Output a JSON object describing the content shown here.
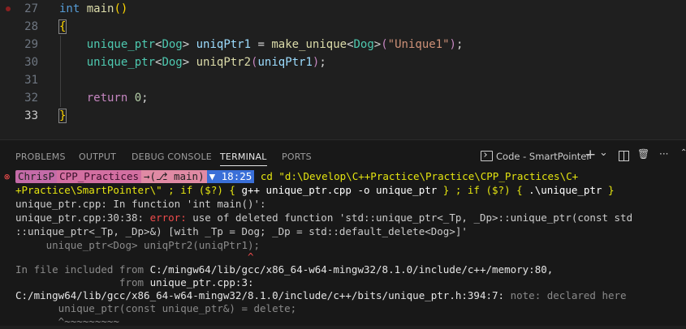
{
  "editor": {
    "lines": [
      {
        "num": "27",
        "tokens": [
          {
            "t": "int",
            "c": "kw"
          },
          {
            "t": " ",
            "c": "pl"
          },
          {
            "t": "main",
            "c": "fn"
          },
          {
            "t": "()",
            "c": "br"
          }
        ]
      },
      {
        "num": "28",
        "tokens": [
          {
            "t": "{",
            "c": "br"
          }
        ]
      },
      {
        "num": "29",
        "tokens": [
          {
            "t": "    ",
            "c": "pl"
          },
          {
            "t": "unique_ptr",
            "c": "ty"
          },
          {
            "t": "<",
            "c": "pl"
          },
          {
            "t": "Dog",
            "c": "ty"
          },
          {
            "t": "> ",
            "c": "pl"
          },
          {
            "t": "uniqPtr1",
            "c": "var"
          },
          {
            "t": " = ",
            "c": "pl"
          },
          {
            "t": "make_unique",
            "c": "fn"
          },
          {
            "t": "<",
            "c": "pl"
          },
          {
            "t": "Dog",
            "c": "ty"
          },
          {
            "t": ">",
            "c": "pl"
          },
          {
            "t": "(",
            "c": "ctl"
          },
          {
            "t": "\"Unique1\"",
            "c": "str"
          },
          {
            "t": ")",
            "c": "ctl"
          },
          {
            "t": ";",
            "c": "pl"
          }
        ]
      },
      {
        "num": "30",
        "tokens": [
          {
            "t": "    ",
            "c": "pl"
          },
          {
            "t": "unique_ptr",
            "c": "ty"
          },
          {
            "t": "<",
            "c": "pl"
          },
          {
            "t": "Dog",
            "c": "ty"
          },
          {
            "t": "> ",
            "c": "pl"
          },
          {
            "t": "uniqPtr2",
            "c": "fn"
          },
          {
            "t": "(",
            "c": "ctl"
          },
          {
            "t": "uniqPtr1",
            "c": "var"
          },
          {
            "t": ")",
            "c": "ctl"
          },
          {
            "t": ";",
            "c": "pl"
          }
        ]
      },
      {
        "num": "31",
        "tokens": []
      },
      {
        "num": "32",
        "tokens": [
          {
            "t": "    ",
            "c": "pl"
          },
          {
            "t": "return",
            "c": "ctl"
          },
          {
            "t": " ",
            "c": "pl"
          },
          {
            "t": "0",
            "c": "num"
          },
          {
            "t": ";",
            "c": "pl"
          }
        ]
      },
      {
        "num": "33",
        "tokens": [
          {
            "t": "}",
            "c": "br"
          }
        ]
      }
    ]
  },
  "panel": {
    "tabs": [
      {
        "label": "PROBLEMS",
        "active": false
      },
      {
        "label": "OUTPUT",
        "active": false
      },
      {
        "label": "DEBUG CONSOLE",
        "active": false
      },
      {
        "label": "TERMINAL",
        "active": true
      },
      {
        "label": "PORTS",
        "active": false
      }
    ],
    "terminal_name": "Code - SmartPointer",
    "add_glyph": "+",
    "dropdown_glyph": "⌄",
    "trash_glyph": "🗑",
    "more_glyph": "···",
    "scroll_glyph": "⌃"
  },
  "terminal": {
    "error_icon": "⊗",
    "prompt": {
      "user": "ChrisP",
      "dir": "CPP_Practices",
      "git": "→(⎇ main)",
      "time": "▼ 18:25"
    },
    "cmd_line1": "cd \"d:\\Develop\\C++Practice\\Practice\\CPP_Practices\\C+",
    "cmd_line2a": "+Practice\\SmartPointer\\\" ; if ($?) { ",
    "cmd_line2b": "g++ unique_ptr.cpp -o unique_ptr",
    "cmd_line2c": " } ; if ($?) { ",
    "cmd_line2d": ".\\unique_ptr",
    "cmd_line2e": " }",
    "out1": "unique_ptr.cpp: In function 'int main()':",
    "out2a": "unique_ptr.cpp:30:38: ",
    "out2b": "error:",
    "out2c": " use of deleted function 'std::unique_ptr<_Tp, _Dp>::unique_ptr(const std",
    "out3": "::unique_ptr<_Tp, _Dp>&) [with _Tp = Dog; _Dp = std::default_delete<Dog>]'",
    "out4": "     unique_ptr<Dog> uniqPtr2(uniqPtr1);",
    "out5": "                                      ^",
    "out6a": "In file included from ",
    "out6b": "C:/mingw64/lib/gcc/x86_64-w64-mingw32/8.1.0/include/c++/memory:80,",
    "out7a": "                 from ",
    "out7b": "unique_ptr.cpp:3:",
    "out8a": "C:/mingw64/lib/gcc/x86_64-w64-mingw32/8.1.0/include/c++/bits/unique_ptr.h:394:7:",
    "out8b": " note: declared here",
    "out9": "       unique_ptr(const unique_ptr&) = delete;",
    "out10": "       ^~~~~~~~~~"
  }
}
